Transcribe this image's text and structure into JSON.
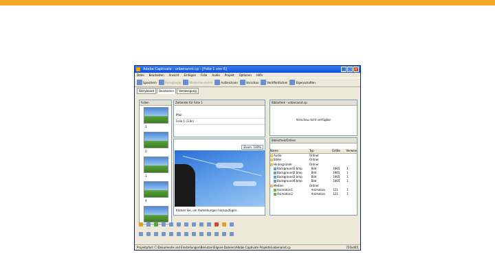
{
  "window": {
    "title": "Adobe Captivate - unbenannt.cp - [Folie 1 von 6]",
    "controls": [
      "_",
      "□",
      "x"
    ]
  },
  "menu": [
    "Datei",
    "Bearbeiten",
    "Ansicht",
    "Einfügen",
    "Folie",
    "Audio",
    "Projekt",
    "Optionen",
    "Hilfe"
  ],
  "toolbar": {
    "buttons": [
      {
        "label": "Speichern",
        "dim": false
      },
      {
        "label": "Rückgängig",
        "dim": true
      },
      {
        "label": "Wiederherstellen",
        "dim": true
      },
      {
        "label": "Aufzeichnen",
        "dim": false
      },
      {
        "label": "Vorschau",
        "dim": false
      },
      {
        "label": "Veröffentlichen",
        "dim": false
      },
      {
        "label": "Eigenschaften",
        "dim": false
      }
    ]
  },
  "view_tabs": [
    "Storyboard",
    "Bearbeiten",
    "Verzweigung"
  ],
  "film_strip": {
    "header": "Folien",
    "frames": [
      "1",
      "2",
      "3",
      "4",
      "5",
      "6"
    ]
  },
  "timeline": {
    "header": "Zeitleiste für Folie 1",
    "rows": [
      "Pfeil",
      "Folie 1 (3.0s)"
    ]
  },
  "stage": {
    "zoom": "Zoom: 100%",
    "caption": "Klicken Sie, um Anmerkungen hinzuzufügen..."
  },
  "library": {
    "header": "Bibliothek - unbenannt.cp",
    "preview_text": "Vorschau nicht verfügbar",
    "tree_label": "Bibliothek/Ordner",
    "columns": [
      "Name",
      "Typ",
      "Größe",
      "Verwendung"
    ],
    "items": [
      {
        "name": "Audio",
        "type": "Ordner",
        "size": "",
        "use": "",
        "kind": "folder"
      },
      {
        "name": "Bilder",
        "type": "Ordner",
        "size": "",
        "use": "",
        "kind": "folder"
      },
      {
        "name": "Hintergründe",
        "type": "Ordner",
        "size": "",
        "use": "",
        "kind": "folder"
      },
      {
        "name": "Background1.bmp",
        "type": "Bild",
        "size": "1665",
        "use": "1",
        "kind": "bmp"
      },
      {
        "name": "Background2.bmp",
        "type": "Bild",
        "size": "1665",
        "use": "1",
        "kind": "bmp"
      },
      {
        "name": "Background3.bmp",
        "type": "Bild",
        "size": "1665",
        "use": "1",
        "kind": "bmp"
      },
      {
        "name": "Background4.bmp",
        "type": "Bild",
        "size": "1665",
        "use": "1",
        "kind": "bmp"
      },
      {
        "name": "Medien",
        "type": "Ordner",
        "size": "",
        "use": "",
        "kind": "folder"
      },
      {
        "name": "Animation1",
        "type": "Animation",
        "size": "121",
        "use": "1",
        "kind": "ani"
      },
      {
        "name": "Animation2",
        "type": "Animation",
        "size": "121",
        "use": "1",
        "kind": "ani"
      }
    ]
  },
  "status": {
    "text": "Projektpfad: C:\\Dokumente und Einstellungen\\Benutzer\\Eigene Dateien\\Adobe Captivate Projekte\\unbenannt.cp",
    "size": "720x405"
  },
  "colors": {
    "accent_bar": "#f5a623",
    "title_bar": "#0b4fd6"
  }
}
